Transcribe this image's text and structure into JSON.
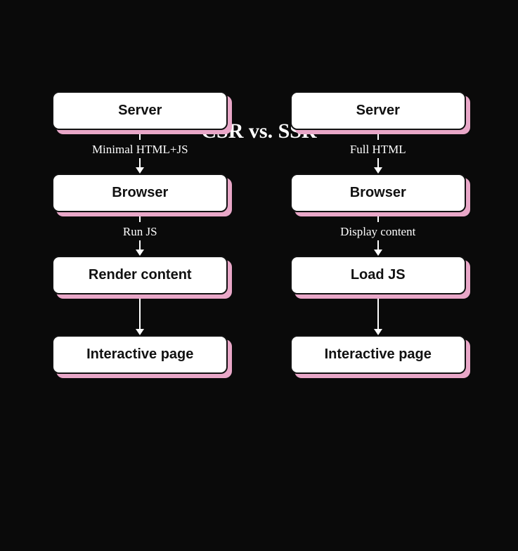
{
  "title": "CSR vs. SSR",
  "columns": {
    "csr": {
      "nodes": [
        "Server",
        "Browser",
        "Render content",
        "Interactive page"
      ],
      "arrows": [
        "Minimal HTML+JS",
        "Run JS",
        ""
      ]
    },
    "ssr": {
      "nodes": [
        "Server",
        "Browser",
        "Load JS",
        "Interactive page"
      ],
      "arrows": [
        "Full HTML",
        "Display content",
        ""
      ]
    }
  }
}
